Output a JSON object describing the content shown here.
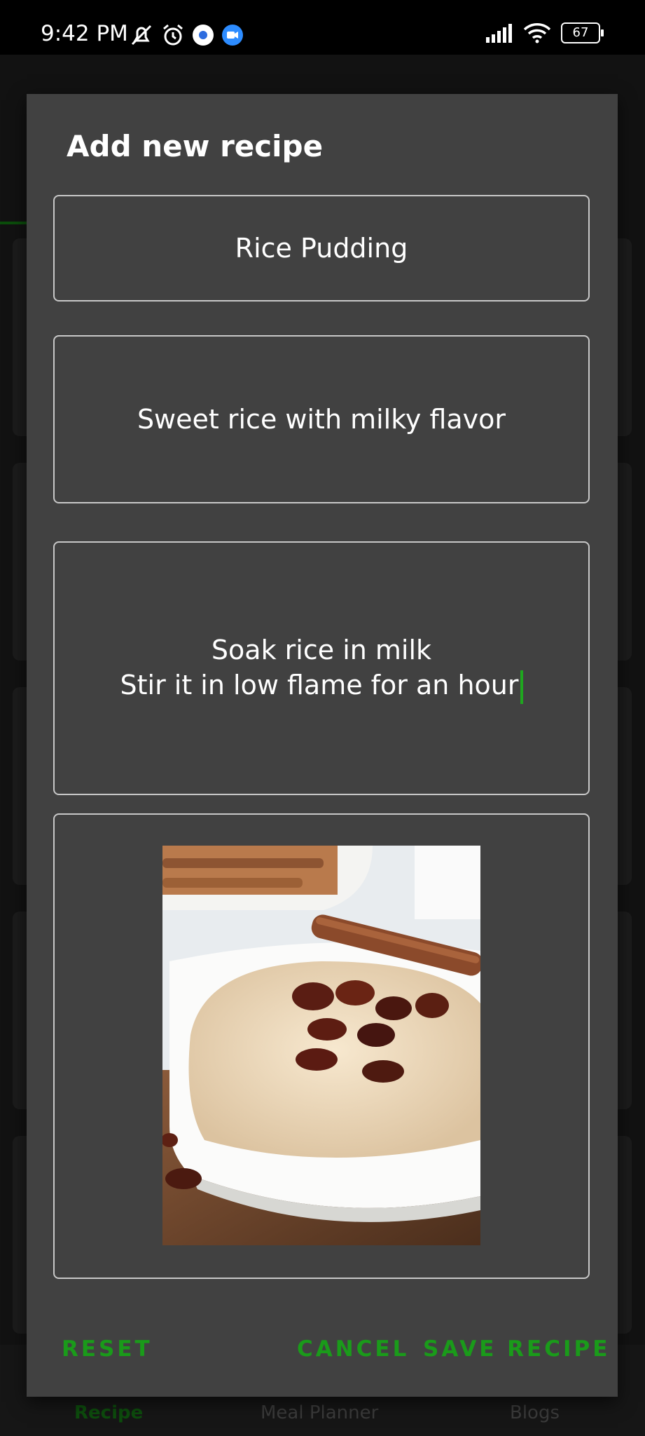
{
  "status_bar": {
    "time": "9:42 PM",
    "battery": "67",
    "icons": [
      "mute-alarm-icon",
      "alarm-icon",
      "app-notification-icon",
      "zoom-icon",
      "signal-icon",
      "wifi-icon",
      "battery-icon"
    ]
  },
  "background_app": {
    "bottom_nav": [
      "Recipe",
      "Meal Planner",
      "Blogs"
    ]
  },
  "dialog": {
    "title": "Add new recipe",
    "name_value": "Rice Pudding",
    "description_value": "Sweet rice with milky flavor",
    "steps_value": "Soak rice in milk\nStir it in low flame for an hour",
    "image": "rice-pudding-photo",
    "buttons": {
      "reset": "RESET",
      "cancel": "CANCEL",
      "save": "SAVE RECIPE"
    }
  },
  "colors": {
    "accent": "#1a9b1a",
    "dialog_bg": "#414141",
    "field_border": "#c8c8c8"
  }
}
